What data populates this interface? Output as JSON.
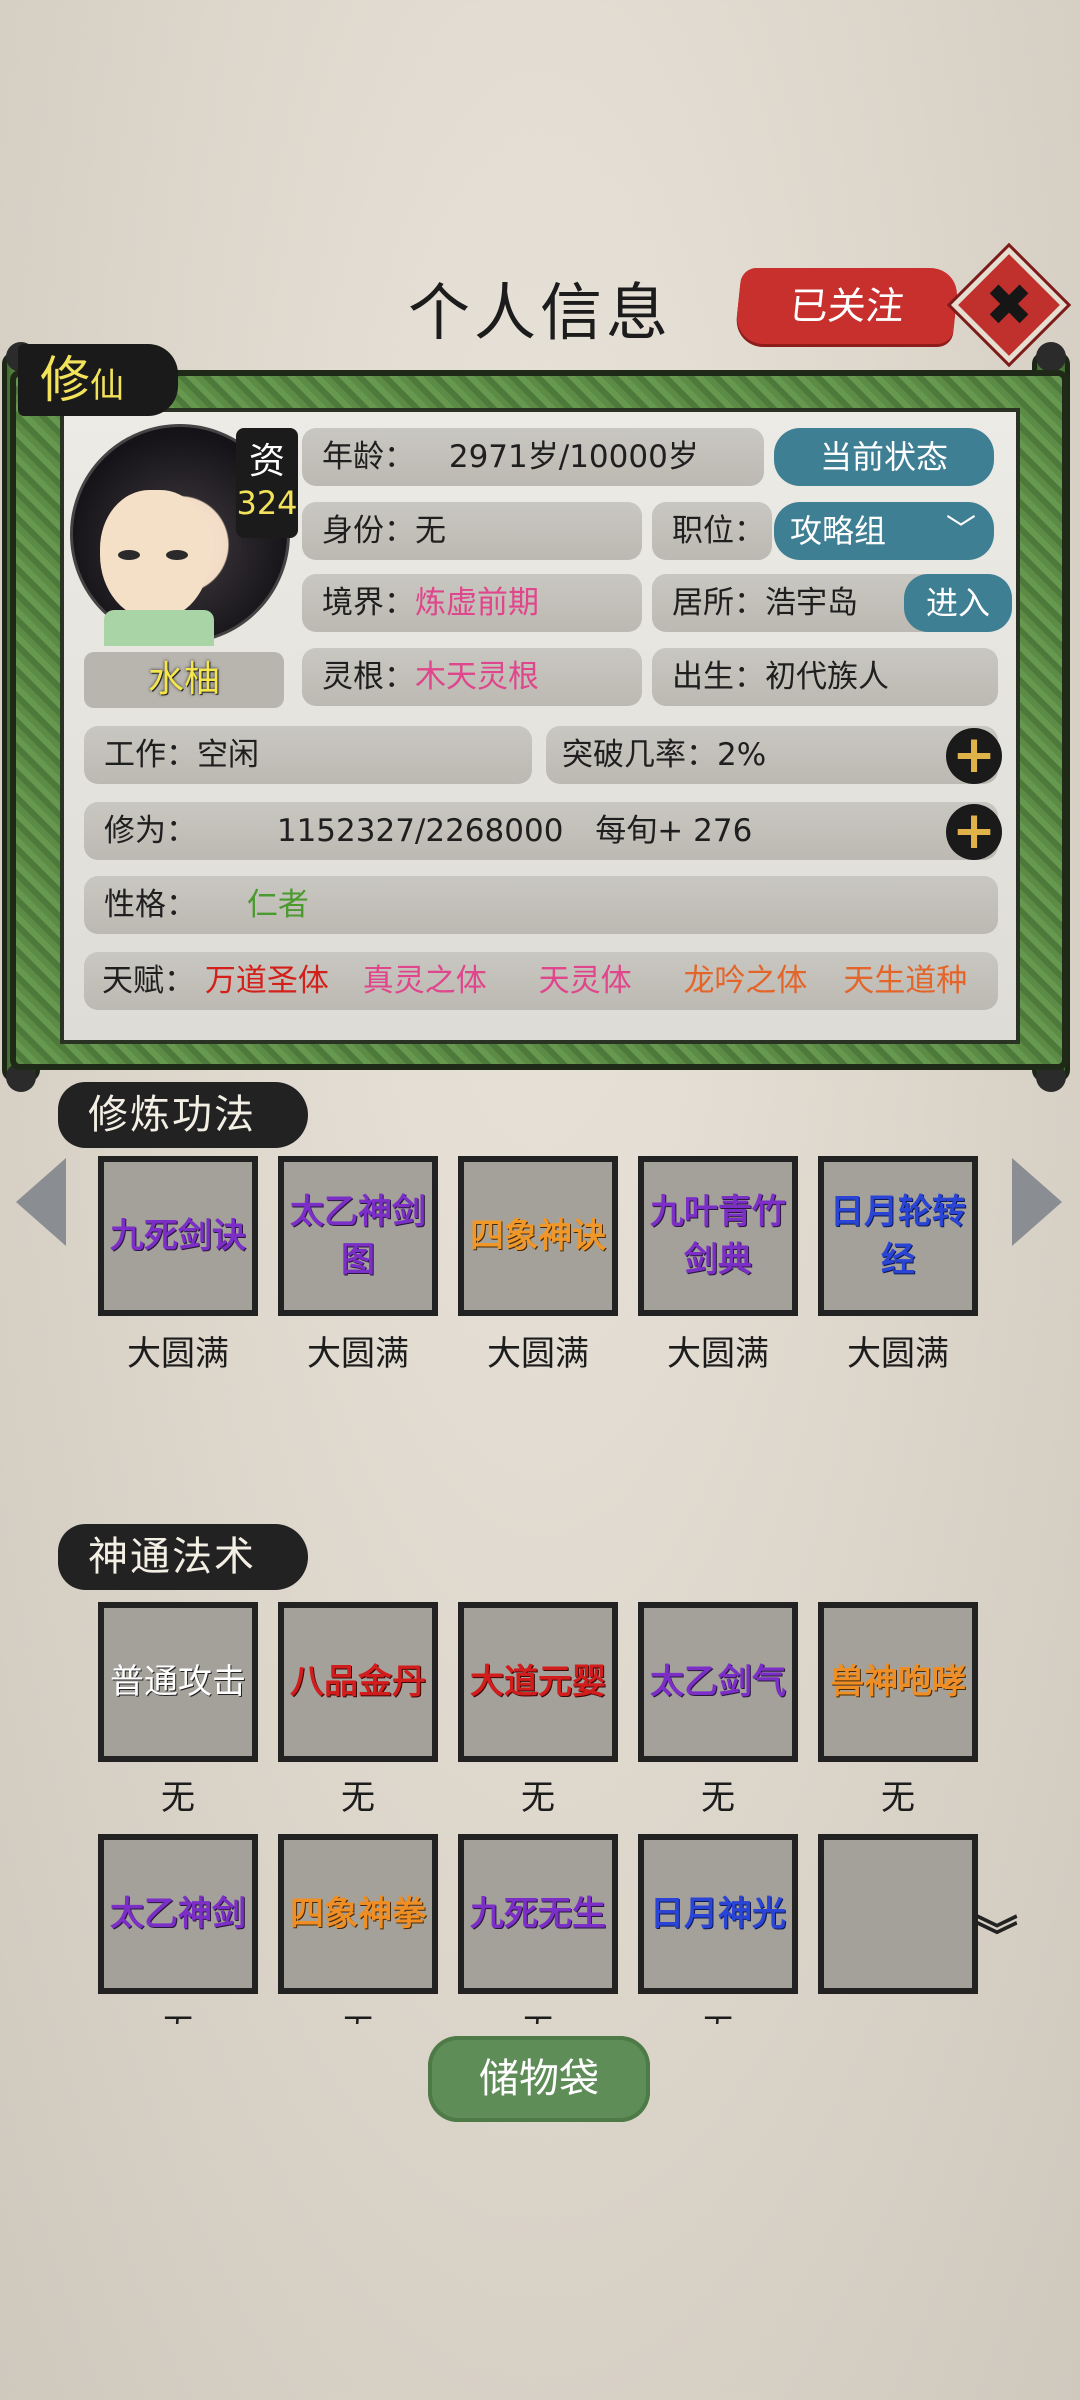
{
  "header": {
    "title": "个人信息",
    "follow_label": "已关注",
    "close_symbol": "✖"
  },
  "character": {
    "realm_tag": "修",
    "realm_tag_small": "仙",
    "aptitude_label": "资",
    "aptitude_value": "324",
    "name": "水柚",
    "age_label": "年龄：",
    "age_value": "2971岁/10000岁",
    "status_button": "当前状态",
    "identity_label": "身份：",
    "identity_value": "无",
    "position_label": "职位：",
    "position_value": "攻略组",
    "realm_label": "境界：",
    "realm_value": "炼虚前期",
    "residence_label": "居所：",
    "residence_value": "浩宇岛",
    "enter_button": "进入",
    "root_label": "灵根：",
    "root_value": "木天灵根",
    "birth_label": "出生：",
    "birth_value": "初代族人",
    "work_label": "工作：",
    "work_value": "空闲",
    "breakthrough_label": "突破几率：",
    "breakthrough_value": "2%",
    "cultivation_label": "修为：",
    "cultivation_value": "1152327/2268000",
    "cultivation_rate": "每旬+ 276",
    "personality_label": "性格：",
    "personality_value": "仁者",
    "talent_label": "天赋：",
    "talents": [
      "万道圣体",
      "真灵之体",
      "天灵体",
      "龙吟之体",
      "天生道种"
    ]
  },
  "cultivation_methods": {
    "title": "修炼功法",
    "items": [
      {
        "name": "九死剑诀",
        "level": "大圆满"
      },
      {
        "name": "太乙神剑图",
        "level": "大圆满"
      },
      {
        "name": "四象神诀",
        "level": "大圆满"
      },
      {
        "name": "九叶青竹剑典",
        "level": "大圆满"
      },
      {
        "name": "日月轮转经",
        "level": "大圆满"
      }
    ]
  },
  "spells": {
    "title": "神通法术",
    "items": [
      {
        "name": "普通攻击",
        "level": "无"
      },
      {
        "name": "八品金丹",
        "level": "无"
      },
      {
        "name": "大道元婴",
        "level": "无"
      },
      {
        "name": "太乙剑气",
        "level": "无"
      },
      {
        "name": "兽神咆哮",
        "level": "无"
      },
      {
        "name": "太乙神剑",
        "level": "无"
      },
      {
        "name": "四象神拳",
        "level": "无"
      },
      {
        "name": "九死无生",
        "level": "无"
      },
      {
        "name": "日月神光",
        "level": "无"
      },
      {
        "name": "",
        "level": ""
      }
    ]
  },
  "footer": {
    "storage_label": "储物袋"
  },
  "colors": {
    "scroll_green": "#5b8b45",
    "follow_red": "#c8302e",
    "status_blue": "#3f7f94",
    "talent_pink": "#e0468c",
    "talent_red": "#d3201b",
    "talent_orange": "#e4652a",
    "personality_green": "#4a9a2f"
  },
  "icons": [
    "close-icon",
    "plus-icon",
    "dropdown-chevron-icon",
    "arrow-left-icon",
    "arrow-right-icon",
    "expand-down-icon"
  ]
}
